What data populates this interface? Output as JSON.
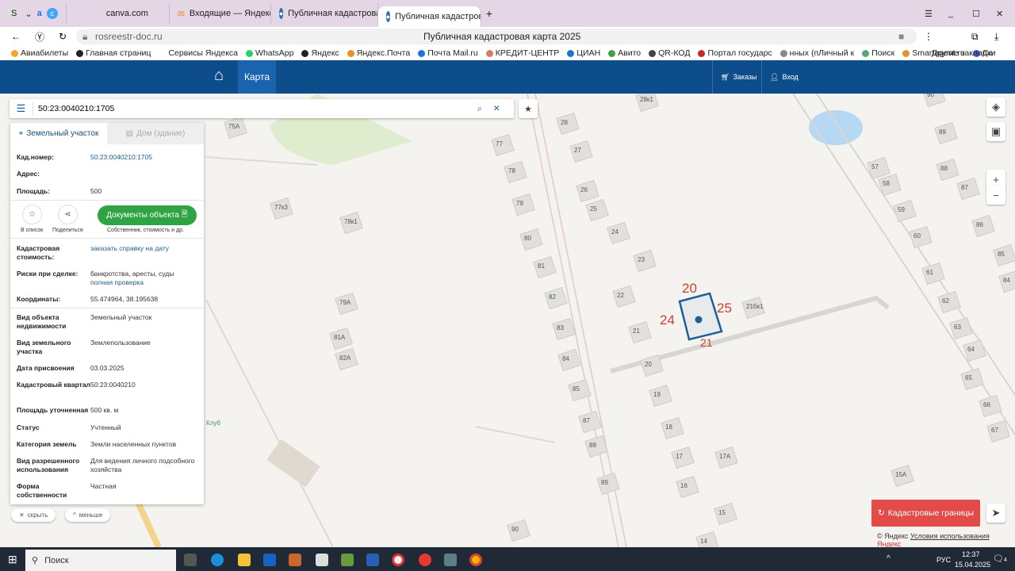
{
  "browser": {
    "tabs": [
      {
        "label": "canva.com"
      },
      {
        "label": "Входящие — Яндекс Почт"
      },
      {
        "label": "Публичная кадастровая"
      },
      {
        "label": "Публичная кадастрова"
      }
    ],
    "profile": "S",
    "url": "rosreestr-doc.ru",
    "page_title": "Публичная кадастровая карта 2025",
    "bookmarks": [
      "Авиабилеты",
      "Главная страниц",
      "Сервисы Яндекса",
      "WhatsApp",
      "Яндекс",
      "Яндекс.Почта",
      "Почта Mail.ru",
      "КРЕДИТ-ЦЕНТР",
      "ЦИАН",
      "Авито",
      "QR-КОД",
      "Портал государс",
      "нных (пЛичный к",
      "Поиск",
      "Smartagent.ru",
      "Са"
    ],
    "other_bookmarks": "Другие закладки"
  },
  "header": {
    "map_tab": "Карта",
    "orders": "Заказы",
    "login": "Вход"
  },
  "search": {
    "value": "50:23:0040210:1705"
  },
  "panel": {
    "tab_land": "Земельный участок",
    "tab_house": "Дом (здание)",
    "top": [
      {
        "label": "Кад.номер:",
        "value": "50:23:0040210:1705"
      },
      {
        "label": "Адрес:",
        "value": ""
      },
      {
        "label": "Площадь:",
        "value": "500"
      }
    ],
    "actions": {
      "favorite": "В список",
      "share": "Поделиться",
      "documents": "Документы объекта",
      "documents_sub": "Собственник, стоимость и др."
    },
    "cost_label": "Кадастровая стоимость:",
    "cost_link": "заказать справку на дату",
    "risk_label": "Риски при сделке:",
    "risk_value": "банкротства, аресты, суды",
    "risk_link": "полная проверка",
    "coords_label": "Координаты:",
    "coords_value": "55.474964, 38.195638",
    "details": [
      {
        "label": "Вид объекта недвижимости",
        "value": "Земельный участок"
      },
      {
        "label": "Вид земельного участка",
        "value": "Землепользование"
      },
      {
        "label": "Дата присвоения",
        "value": "03.03.2025"
      },
      {
        "label": "Кадастровый квартал",
        "value": "50:23:0040210"
      },
      {
        "label": "Площадь уточненная",
        "value": "500 кв. м"
      },
      {
        "label": "Статус",
        "value": "Учтенный"
      },
      {
        "label": "Категория земель",
        "value": "Земли населенных пунктов"
      },
      {
        "label": "Вид разрешенного использования",
        "value": "Для ведения личного подсобного хозяйства"
      },
      {
        "label": "Форма собственности",
        "value": "Частная"
      }
    ],
    "hide": "скрыть",
    "less": "меньше"
  },
  "map": {
    "house_numbers": [
      "28к1",
      "28",
      "77",
      "27",
      "78",
      "26",
      "79",
      "25",
      "75А",
      "77к3",
      "78к1",
      "24",
      "80",
      "23",
      "81",
      "22",
      "82",
      "79А",
      "83",
      "21",
      "81А",
      "84",
      "82А",
      "20",
      "85",
      "19",
      "87",
      "18",
      "88",
      "17",
      "17А",
      "89",
      "16",
      "15",
      "90",
      "14",
      "21бк1",
      "57",
      "58",
      "59",
      "60",
      "61",
      "62",
      "63",
      "64",
      "65",
      "66",
      "67",
      "15А",
      "86",
      "87",
      "88",
      "89",
      "90",
      "85",
      "84"
    ],
    "plot_sides": [
      "20",
      "24",
      "25",
      "21"
    ],
    "club": "Клуб",
    "cadastral_button": "Кадастровые границы",
    "copyright": "© Яндекс",
    "terms": "Условия использования",
    "brand": "Яндекс",
    "plot_color": "#1c5f9e",
    "cadastral_color": "#e24b47"
  },
  "taskbar": {
    "search": "Поиск",
    "lang": "РУС",
    "time": "12:37",
    "date": "15.04.2025",
    "notifications": "4"
  }
}
